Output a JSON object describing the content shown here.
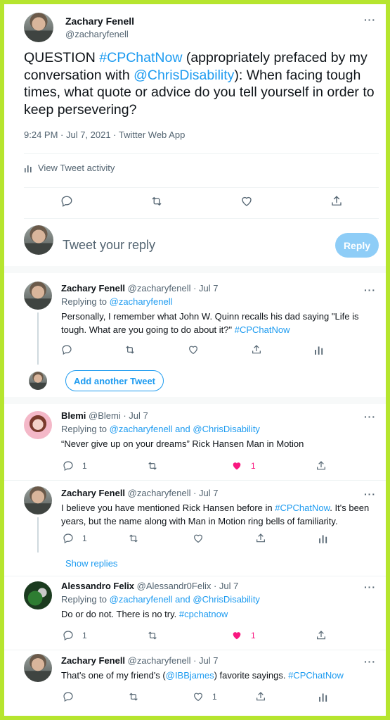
{
  "main_tweet": {
    "name": "Zachary Fenell",
    "handle": "@zacharyfenell",
    "more": "···",
    "text_parts": {
      "p1": "QUESTION ",
      "hashtag": "#CPChatNow",
      "p2": " (appropriately prefaced by my conversation with ",
      "mention": "@ChrisDisability",
      "p3": "): When facing tough times, what quote or advice do you tell yourself in order to keep persevering?"
    },
    "meta": "9:24 PM · Jul 7, 2021 · Twitter Web App",
    "activity_label": "View Tweet activity"
  },
  "reply_composer": {
    "placeholder": "Tweet your reply",
    "button": "Reply"
  },
  "thread": {
    "tweet1": {
      "name": "Zachary Fenell",
      "meta": "@zacharyfenell · Jul 7",
      "replying_to_label": "Replying to",
      "replying_to": "@zacharyfenell",
      "text": "Personally, I remember what John W. Quinn recalls his dad saying \"Life is tough. What are you going to do about it?\"",
      "hashtag": "#CPChatNow"
    },
    "add_another": "Add another Tweet"
  },
  "reply_blemi": {
    "name": "Blemi",
    "meta": "@Blemi · Jul 7",
    "replying_to_label": "Replying to",
    "replying_to": "@zacharyfenell and @ChrisDisability",
    "text": "“Never give up on your dreams” Rick Hansen Man in Motion",
    "reply_count": "1",
    "like_count": "1",
    "liked_color": "#f91880"
  },
  "reply_zach2": {
    "name": "Zachary Fenell",
    "meta": "@zacharyfenell · Jul 7",
    "text_a": "I believe you have mentioned Rick Hansen before in ",
    "hashtag": "#CPChatNow",
    "text_b": ". It's been years, but the name along with Man in Motion ring bells of familiarity.",
    "reply_count": "1"
  },
  "show_replies": "Show replies",
  "reply_alex": {
    "name": "Alessandro Felix",
    "meta": "@Alessandr0Felix · Jul 7",
    "replying_to_label": "Replying to",
    "replying_to": "@zacharyfenell and @ChrisDisability",
    "text": "Do or do not. There is no try.",
    "hashtag": "#cpchatnow",
    "reply_count": "1",
    "like_count": "1"
  },
  "reply_zach3": {
    "name": "Zachary Fenell",
    "meta": "@zacharyfenell · Jul 7",
    "text_a": "That's one of my friend's (",
    "mention": "@IBBjames",
    "text_b": ") favorite sayings.",
    "hashtag": "#CPChatNow",
    "like_count": "1"
  },
  "colors": {
    "accent": "#1d9bf0",
    "frame": "#b6e52e",
    "like": "#f91880"
  }
}
